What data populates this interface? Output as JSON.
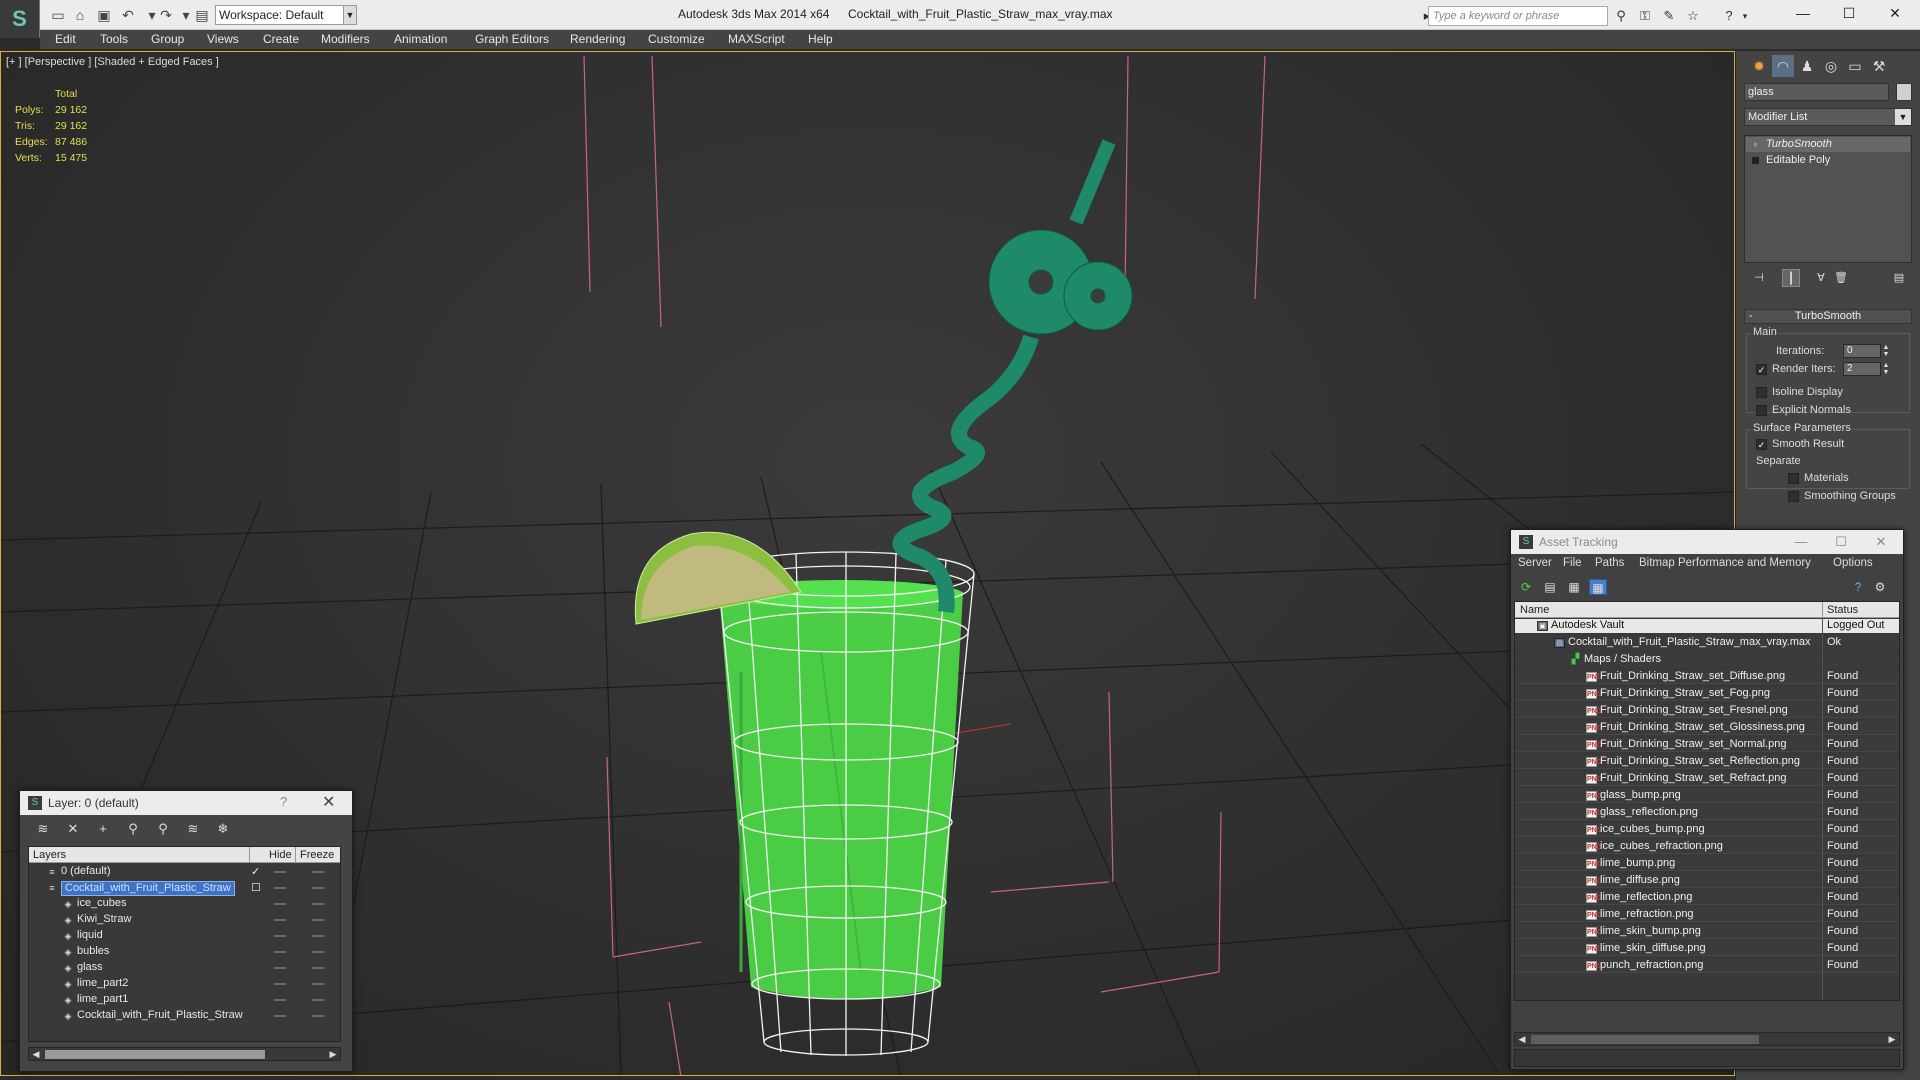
{
  "titlebar": {
    "workspace_label": "Workspace: Default",
    "app_title": "Autodesk 3ds Max  2014 x64",
    "file_title": "Cocktail_with_Fruit_Plastic_Straw_max_vray.max",
    "search_placeholder": "Type a keyword or phrase"
  },
  "menu": [
    "Edit",
    "Tools",
    "Group",
    "Views",
    "Create",
    "Modifiers",
    "Animation",
    "Graph Editors",
    "Rendering",
    "Customize",
    "MAXScript",
    "Help"
  ],
  "viewport": {
    "label": "[+ ] [Perspective ] [Shaded + Edged Faces ]",
    "stats": {
      "header": "Total",
      "rows": [
        {
          "key": "Polys:",
          "value": "29 162"
        },
        {
          "key": "Tris:",
          "value": "29 162"
        },
        {
          "key": "Edges:",
          "value": "87 486"
        },
        {
          "key": "Verts:",
          "value": "15 475"
        }
      ]
    }
  },
  "command_panel": {
    "object_name": "glass",
    "modifier_list": "Modifier List",
    "stack": [
      "TurboSmooth",
      "Editable Poly"
    ],
    "rollout_title": "TurboSmooth",
    "main_group": "Main",
    "iterations_label": "Iterations:",
    "iterations_value": "0",
    "render_iters_label": "Render Iters:",
    "render_iters_value": "2",
    "render_iters_checked": true,
    "isoline_label": "Isoline Display",
    "isoline_checked": false,
    "explicit_normals_label": "Explicit Normals",
    "explicit_normals_checked": false,
    "surface_group": "Surface Parameters",
    "smooth_result_label": "Smooth Result",
    "smooth_result_checked": true,
    "separate_label": "Separate",
    "materials_label": "Materials",
    "materials_checked": false,
    "smoothing_groups_label": "Smoothing Groups",
    "smoothing_groups_checked": false
  },
  "asset_tracking": {
    "title": "Asset Tracking",
    "menu": [
      "Server",
      "File",
      "Paths",
      "Bitmap Performance and Memory",
      "Options"
    ],
    "col_name": "Name",
    "col_status": "Status",
    "vault": {
      "name": "Autodesk Vault",
      "status": "Logged Out"
    },
    "file": {
      "name": "Cocktail_with_Fruit_Plastic_Straw_max_vray.max",
      "status": "Ok"
    },
    "maps": {
      "name": "Maps / Shaders"
    },
    "assets": [
      {
        "name": "Fruit_Drinking_Straw_set_Diffuse.png",
        "status": "Found"
      },
      {
        "name": "Fruit_Drinking_Straw_set_Fog.png",
        "status": "Found"
      },
      {
        "name": "Fruit_Drinking_Straw_set_Fresnel.png",
        "status": "Found"
      },
      {
        "name": "Fruit_Drinking_Straw_set_Glossiness.png",
        "status": "Found"
      },
      {
        "name": "Fruit_Drinking_Straw_set_Normal.png",
        "status": "Found"
      },
      {
        "name": "Fruit_Drinking_Straw_set_Reflection.png",
        "status": "Found"
      },
      {
        "name": "Fruit_Drinking_Straw_set_Refract.png",
        "status": "Found"
      },
      {
        "name": "glass_bump.png",
        "status": "Found"
      },
      {
        "name": "glass_reflection.png",
        "status": "Found"
      },
      {
        "name": "ice_cubes_bump.png",
        "status": "Found"
      },
      {
        "name": "ice_cubes_refraction.png",
        "status": "Found"
      },
      {
        "name": "lime_bump.png",
        "status": "Found"
      },
      {
        "name": "lime_diffuse.png",
        "status": "Found"
      },
      {
        "name": "lime_reflection.png",
        "status": "Found"
      },
      {
        "name": "lime_refraction.png",
        "status": "Found"
      },
      {
        "name": "lime_skin_bump.png",
        "status": "Found"
      },
      {
        "name": "lime_skin_diffuse.png",
        "status": "Found"
      },
      {
        "name": "punch_refraction.png",
        "status": "Found"
      }
    ]
  },
  "layer_window": {
    "title": "Layer: 0 (default)",
    "help": "?",
    "col_layers": "Layers",
    "col_hide": "Hide",
    "col_freeze": "Freeze",
    "layers": [
      {
        "name": "0 (default)",
        "level": 0,
        "selected": false,
        "mark": "✓"
      },
      {
        "name": "Cocktail_with_Fruit_Plastic_Straw",
        "level": 0,
        "selected": true,
        "mark": "☐"
      },
      {
        "name": "ice_cubes",
        "level": 1,
        "selected": false,
        "mark": ""
      },
      {
        "name": "Kiwi_Straw",
        "level": 1,
        "selected": false,
        "mark": ""
      },
      {
        "name": "liquid",
        "level": 1,
        "selected": false,
        "mark": ""
      },
      {
        "name": "bubles",
        "level": 1,
        "selected": false,
        "mark": ""
      },
      {
        "name": "glass",
        "level": 1,
        "selected": false,
        "mark": ""
      },
      {
        "name": "lime_part2",
        "level": 1,
        "selected": false,
        "mark": ""
      },
      {
        "name": "lime_part1",
        "level": 1,
        "selected": false,
        "mark": ""
      },
      {
        "name": "Cocktail_with_Fruit_Plastic_Straw",
        "level": 1,
        "selected": false,
        "mark": ""
      }
    ]
  },
  "colors": {
    "viewport_border": "#d7b13d",
    "stats_text": "#e7df4f",
    "selection_blue": "#3d73c7",
    "liquid_green": "#4fd64a",
    "straw_teal": "#1f8a6a"
  }
}
